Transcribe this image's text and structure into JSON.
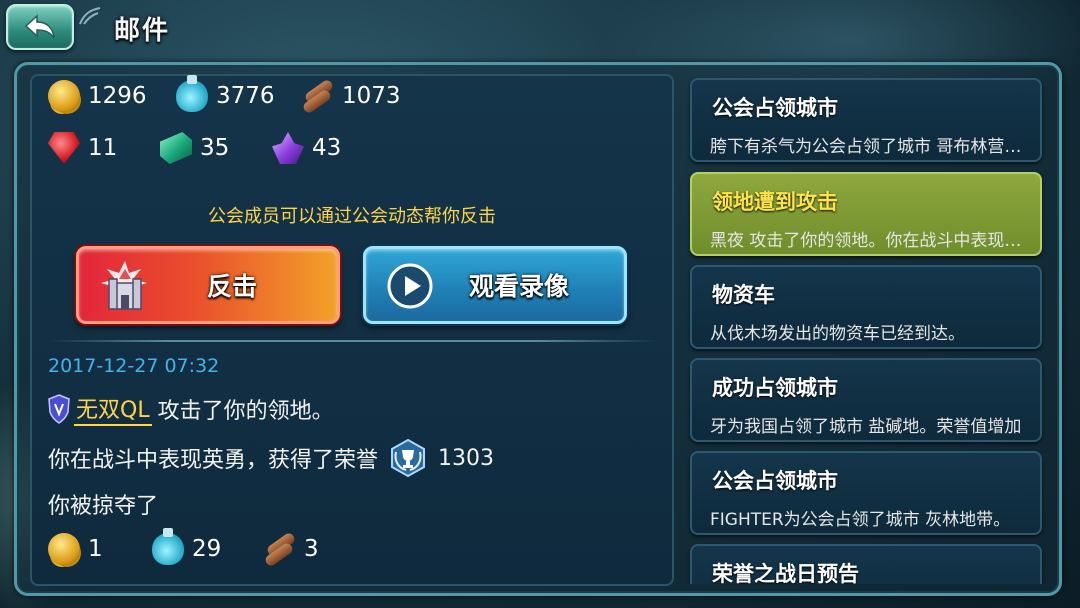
{
  "header": {
    "title": "邮件"
  },
  "resources": {
    "gold": "1296",
    "elixir": "3776",
    "wood": "1073",
    "ruby": "11",
    "emerald": "35",
    "crystal": "43"
  },
  "detail": {
    "notice": "公会成员可以通过公会动态帮你反击",
    "counter_label": "反击",
    "replay_label": "观看录像",
    "timestamp": "2017-12-27 07:32",
    "attacker_name": "无双QL",
    "attack_text": "攻击了你的领地。",
    "honor_text": "你在战斗中表现英勇，获得了荣誉",
    "honor_value": "1303",
    "plunder_text": "你被掠夺了",
    "loss": {
      "gold": "1",
      "elixir": "29",
      "wood": "3"
    }
  },
  "mails": [
    {
      "title": "公会占领城市",
      "preview": "胯下有杀气为公会占领了城市 哥布林营地。",
      "active": false
    },
    {
      "title": "领地遭到攻击",
      "preview": "黑夜 攻击了你的领地。你在战斗中表现英勇",
      "active": true
    },
    {
      "title": "物资车",
      "preview": "从伐木场发出的物资车已经到达。",
      "active": false
    },
    {
      "title": "成功占领城市",
      "preview": "牙为我国占领了城市 盐碱地。荣誉值增加",
      "active": false
    },
    {
      "title": "公会占领城市",
      "preview": "FIGHTER为公会占领了城市 灰林地带。",
      "active": false
    },
    {
      "title": "荣誉之战日预告",
      "preview": "",
      "active": false
    }
  ],
  "colors": {
    "accent_gold": "#ffd54a",
    "timestamp_blue": "#3fb5ee",
    "active_mail": "#8fa83f",
    "counter_button": "#e3263b",
    "replay_button": "#1f7fb4"
  }
}
